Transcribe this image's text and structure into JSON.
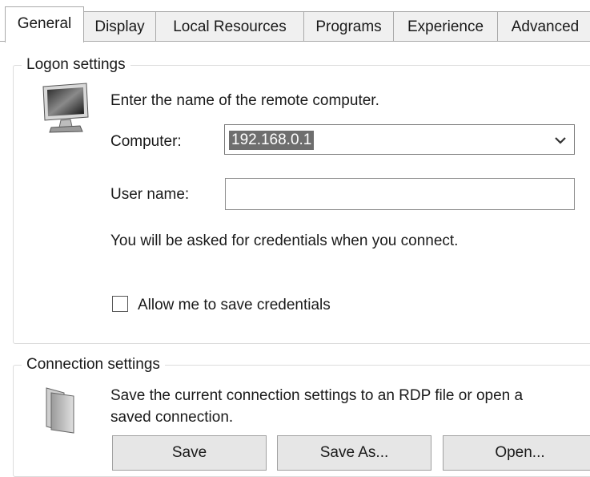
{
  "tabs": [
    {
      "label": "General",
      "active": true
    },
    {
      "label": "Display"
    },
    {
      "label": "Local Resources"
    },
    {
      "label": "Programs"
    },
    {
      "label": "Experience"
    },
    {
      "label": "Advanced"
    }
  ],
  "logon": {
    "title": "Logon settings",
    "icon": "computer-icon",
    "instruction": "Enter the name of the remote computer.",
    "computer_label": "Computer:",
    "computer_value": "192.168.0.1",
    "username_label": "User name:",
    "username_value": "",
    "credentials_note": "You will be asked for credentials when you connect.",
    "save_credentials_label": "Allow me to save credentials",
    "save_credentials_checked": false
  },
  "connection": {
    "title": "Connection settings",
    "icon": "folder-icon",
    "description_line1": "Save the current connection settings to an RDP file or open a",
    "description_line2": "saved connection.",
    "save_label": "Save",
    "save_as_label": "Save As...",
    "open_label": "Open..."
  }
}
